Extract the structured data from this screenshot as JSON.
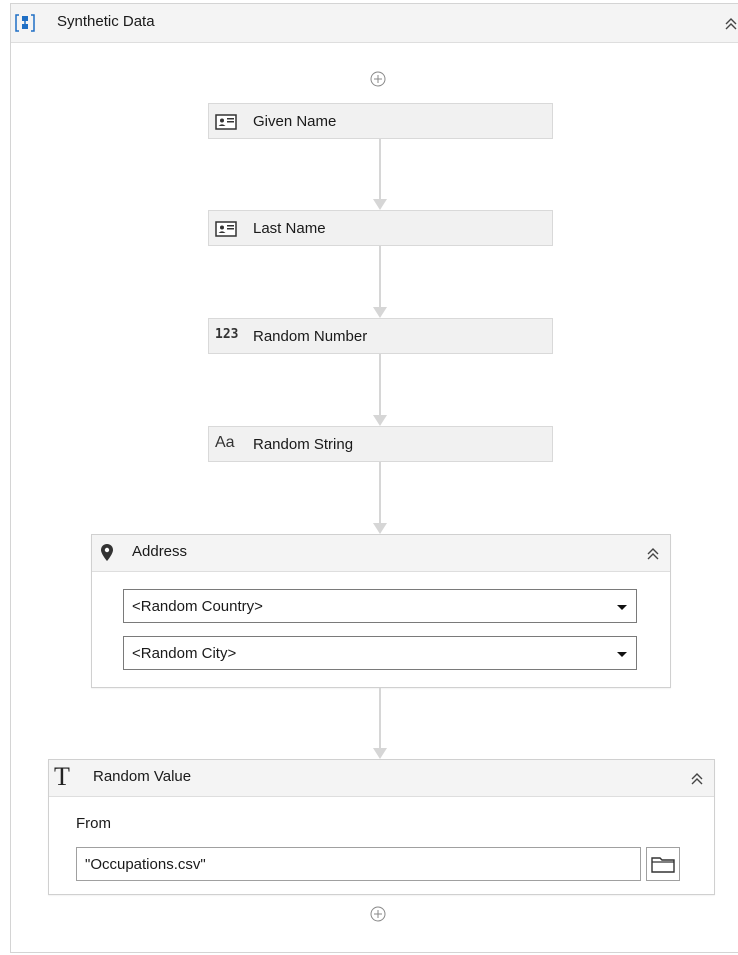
{
  "sequence": {
    "title": "Synthetic Data",
    "icon": "sequence-icon",
    "collapse_icon": "double-chevron-up-icon"
  },
  "activities": [
    {
      "label": "Given Name",
      "icon": "id-card-icon"
    },
    {
      "label": "Last Name",
      "icon": "id-card-icon"
    },
    {
      "label": "Random Number",
      "icon": "number-123-icon"
    },
    {
      "label": "Random String",
      "icon": "text-aa-icon"
    }
  ],
  "address": {
    "title": "Address",
    "icon": "location-pin-icon",
    "country": "<Random Country>",
    "city": "<Random City>"
  },
  "random_value": {
    "title": "Random Value",
    "icon": "text-t-icon",
    "from_label": "From",
    "from_value": "\"Occupations.csv\"",
    "browse_icon": "folder-icon"
  },
  "colors": {
    "header_bg": "#f4f4f4",
    "border": "#d0d0d0",
    "arrow": "#d6d6d6",
    "accent_blue": "#1f6fc5"
  }
}
